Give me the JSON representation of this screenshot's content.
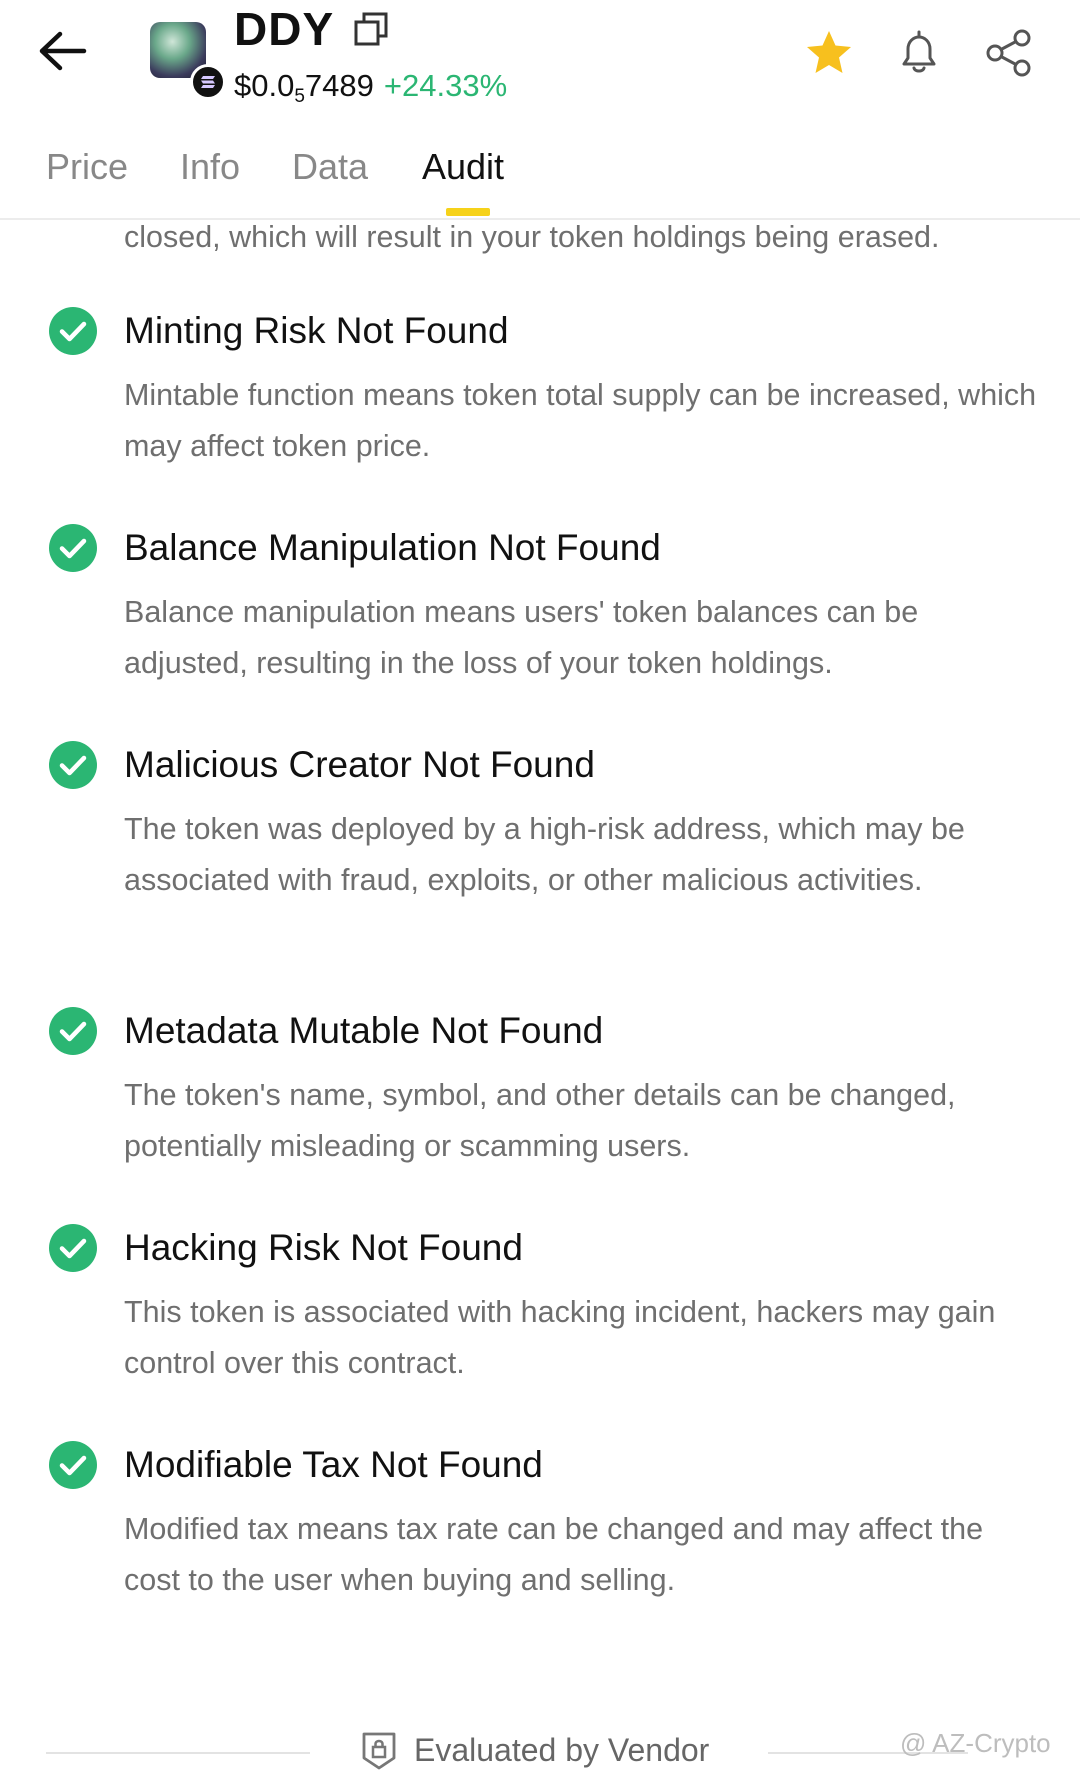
{
  "header": {
    "ticker": "DDY",
    "price_prefix": "$0.0",
    "price_zeros": "5",
    "price_rest": "7489",
    "change": "+24.33%",
    "accent_color": "#2bb673",
    "star_color": "#f7c01e"
  },
  "tabs": [
    {
      "label": "Price",
      "active": false
    },
    {
      "label": "Info",
      "active": false
    },
    {
      "label": "Data",
      "active": false
    },
    {
      "label": "Audit",
      "active": true
    }
  ],
  "audit": {
    "partial_text": "closed, which will result in your token holdings being erased.",
    "items": [
      {
        "title": "Minting Risk Not Found",
        "description": "Mintable function means token total supply can be increased, which may affect token price.",
        "icon": "check-circle-icon"
      },
      {
        "title": "Balance Manipulation Not Found",
        "description": "Balance manipulation means users' token balances can be adjusted, resulting in the loss of your token holdings.",
        "icon": "check-circle-icon"
      },
      {
        "title": "Malicious Creator Not Found",
        "description": "The token was deployed by a high-risk address, which may be associated with fraud, exploits, or other malicious activities.",
        "icon": "check-circle-icon"
      },
      {
        "title": "Metadata Mutable Not Found",
        "description": "The token's name, symbol, and other details can be changed, potentially misleading or scamming users.",
        "icon": "check-circle-icon"
      },
      {
        "title": "Hacking Risk Not Found",
        "description": "This token is associated with hacking incident, hackers may gain control over this contract.",
        "icon": "check-circle-icon"
      },
      {
        "title": "Modifiable Tax Not Found",
        "description": "Modified tax means tax rate can be changed and may affect the cost to the user when buying and selling.",
        "icon": "check-circle-icon"
      }
    ]
  },
  "footer": {
    "evaluated_by": "Evaluated by Vendor",
    "watermark": "@ AZ-Crypto"
  }
}
